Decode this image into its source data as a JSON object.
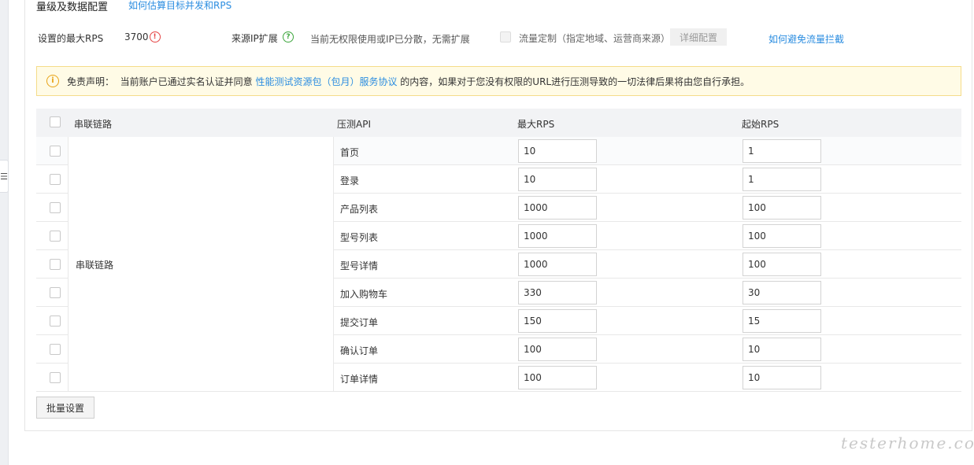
{
  "section": {
    "title": "量级及数据配置",
    "help_link": "如何估算目标并发和RPS"
  },
  "config": {
    "max_rps_label": "设置的最大RPS",
    "max_rps_value": "3700",
    "ip_expand_label": "来源IP扩展",
    "ip_note": "当前无权限使用或IP已分散，无需扩展",
    "flow_custom_label": "流量定制（指定地域、运营商来源）",
    "detail_button": "详细配置",
    "avoid_link": "如何避免流量拦截"
  },
  "disclaimer": {
    "prefix": "免责声明：  当前账户已通过实名认证并同意 ",
    "link": "性能测试资源包（包月）服务协议",
    "suffix": " 的内容，如果对于您没有权限的URL进行压测导致的一切法律后果将由您自行承担。"
  },
  "table": {
    "headers": {
      "chain": "串联链路",
      "api": "压测API",
      "max_rps": "最大RPS",
      "start_rps": "起始RPS"
    },
    "chain_name": "串联链路",
    "rows": [
      {
        "api": "首页",
        "max_rps": "10",
        "start_rps": "1"
      },
      {
        "api": "登录",
        "max_rps": "10",
        "start_rps": "1"
      },
      {
        "api": "产品列表",
        "max_rps": "1000",
        "start_rps": "100"
      },
      {
        "api": "型号列表",
        "max_rps": "1000",
        "start_rps": "100"
      },
      {
        "api": "型号详情",
        "max_rps": "1000",
        "start_rps": "100"
      },
      {
        "api": "加入购物车",
        "max_rps": "330",
        "start_rps": "30"
      },
      {
        "api": "提交订单",
        "max_rps": "150",
        "start_rps": "15"
      },
      {
        "api": "确认订单",
        "max_rps": "100",
        "start_rps": "10"
      },
      {
        "api": "订单详情",
        "max_rps": "100",
        "start_rps": "10"
      }
    ]
  },
  "batch_button": "批量设置",
  "watermark": "testerhome.com"
}
